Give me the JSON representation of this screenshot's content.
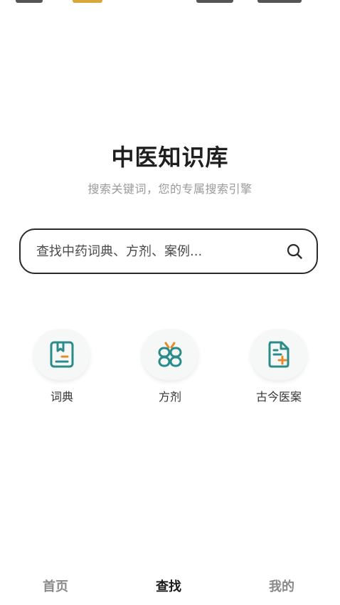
{
  "hero": {
    "title": "中医知识库",
    "subtitle": "搜索关键词，您的专属搜索引擎"
  },
  "search": {
    "placeholder": "查找中药词典、方剂、案例..."
  },
  "shortcuts": [
    {
      "label": "词典",
      "icon": "book-icon"
    },
    {
      "label": "方剂",
      "icon": "herb-bundle-icon"
    },
    {
      "label": "古今医案",
      "icon": "document-plus-icon"
    }
  ],
  "tabs": [
    {
      "label": "首页",
      "active": false
    },
    {
      "label": "查找",
      "active": true
    },
    {
      "label": "我的",
      "active": false
    }
  ],
  "colors": {
    "icon_teal": "#2a8c8a",
    "icon_orange": "#e58a2d",
    "tab_active": "#1a1a1a",
    "tab_inactive": "#8a8a8a"
  }
}
